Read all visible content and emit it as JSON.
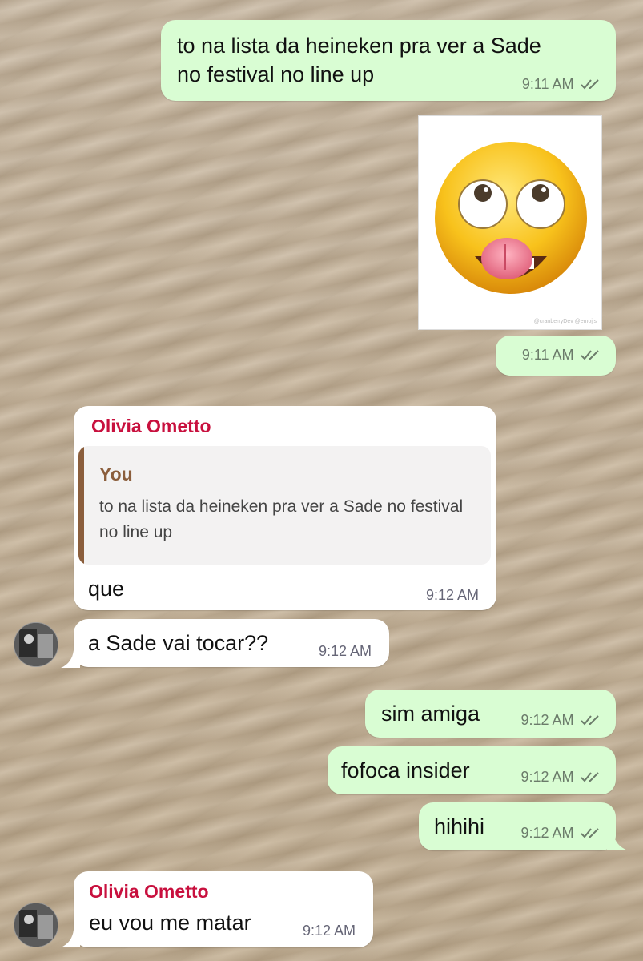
{
  "messages": [
    {
      "id": "m1",
      "dir": "out",
      "text": "to na lista da heineken pra ver a Sade\nno festival no line up",
      "time": "9:11 AM"
    },
    {
      "id": "m2",
      "dir": "out",
      "type": "image",
      "image_caption": "@cranberryDev @emojis",
      "time": "9:11 AM"
    },
    {
      "id": "m3",
      "dir": "in",
      "sender": "Olivia Ometto",
      "quote": {
        "author": "You",
        "text": "to na lista da heineken pra ver a Sade no festival no line up"
      },
      "text": "que",
      "time": "9:12 AM"
    },
    {
      "id": "m4",
      "dir": "in",
      "text": "a Sade vai tocar??",
      "time": "9:12 AM"
    },
    {
      "id": "m5",
      "dir": "out",
      "text": "sim amiga",
      "time": "9:12 AM"
    },
    {
      "id": "m6",
      "dir": "out",
      "text": "fofoca insider",
      "time": "9:12 AM"
    },
    {
      "id": "m7",
      "dir": "out",
      "text": "hihihi",
      "time": "9:12 AM"
    },
    {
      "id": "m8",
      "dir": "in",
      "sender": "Olivia Ometto",
      "text": "eu vou me matar",
      "time": "9:12 AM"
    }
  ],
  "colors": {
    "outgoing_bubble": "#d9fdd3",
    "incoming_bubble": "#ffffff",
    "sender_name": "#c8103e",
    "quote_author": "#8b5e3c",
    "tick": "#6b7b6a"
  },
  "icons": {
    "read_ticks": "double-check-icon",
    "avatar": "contact-avatar"
  }
}
